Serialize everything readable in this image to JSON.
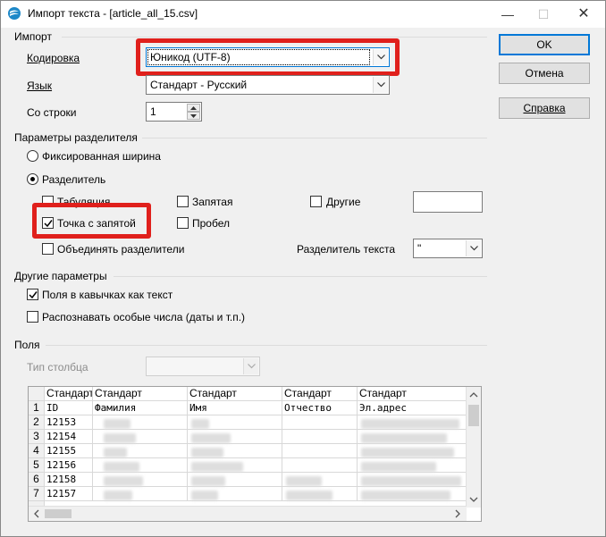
{
  "window": {
    "title": "Импорт текста - [article_all_15.csv]",
    "minimize": "—",
    "maximize": "☐",
    "close": "✕"
  },
  "buttons": {
    "ok": "OK",
    "cancel": "Отмена",
    "help": "Справка"
  },
  "import_group": {
    "title": "Импорт",
    "encoding_label": "Кодировка",
    "encoding_value": "Юникод (UTF-8)",
    "language_label": "Язык",
    "language_value": "Стандарт - Русский",
    "from_row_label": "Со строки",
    "from_row_value": "1"
  },
  "separator_group": {
    "title": "Параметры разделителя",
    "fixed_width": "Фиксированная ширина",
    "separated": "Разделитель",
    "tab": "Табуляция",
    "comma": "Запятая",
    "other": "Другие",
    "semicolon": "Точка с запятой",
    "space": "Пробел",
    "merge": "Объединять разделители",
    "text_delimiter_label": "Разделитель текста",
    "text_delimiter_value": "\""
  },
  "other_group": {
    "title": "Другие параметры",
    "quoted_as_text": "Поля в кавычках как текст",
    "detect_special": "Распознавать особые числа (даты и т.п.)"
  },
  "fields_group": {
    "title": "Поля",
    "column_type_label": "Тип столбца"
  },
  "preview": {
    "column_types": [
      "Стандарт",
      "Стандарт",
      "Стандарт",
      "Стандарт",
      "Стандарт"
    ],
    "header_row": [
      "ID",
      "Фамилия",
      "Имя",
      "Отчество",
      "Эл.адрес"
    ],
    "row_numbers": [
      "1",
      "2",
      "3",
      "4",
      "5",
      "6",
      "7"
    ],
    "ids": [
      "12153",
      "12154",
      "12155",
      "12156",
      "12158",
      "12157"
    ]
  },
  "colors": {
    "highlight": "#e0201c",
    "accent": "#0078d7"
  }
}
